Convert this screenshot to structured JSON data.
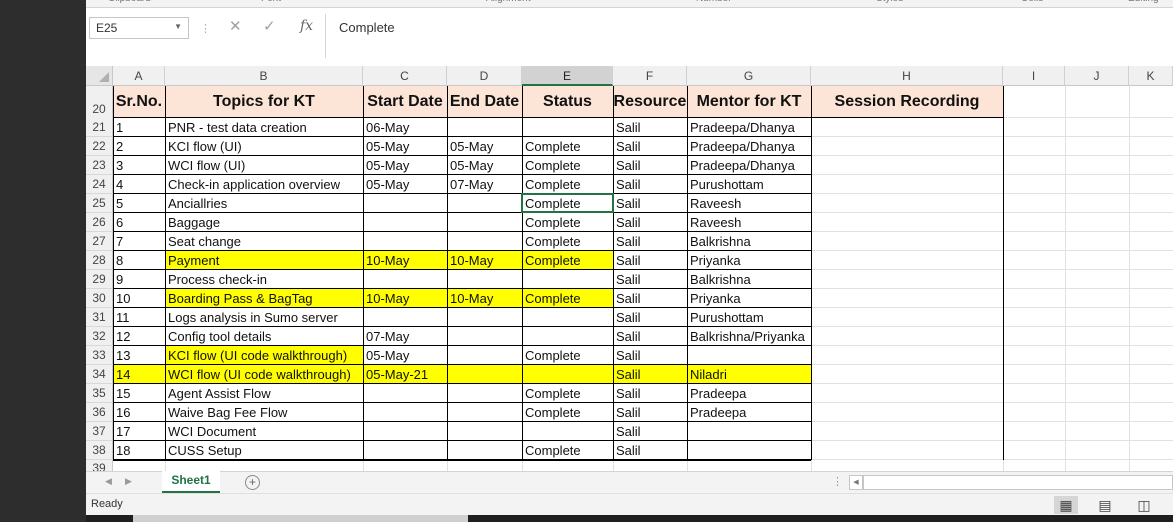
{
  "ribbon": {
    "groups": [
      "Clipboard",
      "Font",
      "Alignment",
      "Number",
      "Styles",
      "Cells",
      "Editing"
    ]
  },
  "formula_bar": {
    "name_box": "E25",
    "content": "Complete"
  },
  "columns": [
    "A",
    "B",
    "C",
    "D",
    "E",
    "F",
    "G",
    "H",
    "I",
    "J",
    "K"
  ],
  "header_row": {
    "row_num": "20",
    "cells": [
      "Sr.No.",
      "Topics for KT",
      "Start Date",
      "End Date",
      "Status",
      "Resource",
      "Mentor for KT",
      "Session Recording"
    ]
  },
  "rows": [
    {
      "row_num": "21",
      "cells": [
        "1",
        "PNR - test data creation",
        "06-May",
        "",
        "",
        "Salil",
        "Pradeepa/Dhanya",
        ""
      ]
    },
    {
      "row_num": "22",
      "cells": [
        "2",
        "KCI flow (UI)",
        "05-May",
        "05-May",
        "Complete",
        "Salil",
        "Pradeepa/Dhanya",
        ""
      ]
    },
    {
      "row_num": "23",
      "cells": [
        "3",
        "WCI flow (UI)",
        "05-May",
        "05-May",
        "Complete",
        "Salil",
        "Pradeepa/Dhanya",
        ""
      ]
    },
    {
      "row_num": "24",
      "cells": [
        "4",
        "Check-in application overview",
        "05-May",
        "07-May",
        "Complete",
        "Salil",
        "Purushottam",
        ""
      ]
    },
    {
      "row_num": "25",
      "cells": [
        "5",
        "Anciallries",
        "",
        "",
        "Complete",
        "Salil",
        "Raveesh",
        ""
      ]
    },
    {
      "row_num": "26",
      "cells": [
        "6",
        "Baggage",
        "",
        "",
        "Complete",
        "Salil",
        "Raveesh",
        ""
      ]
    },
    {
      "row_num": "27",
      "cells": [
        "7",
        "Seat change",
        "",
        "",
        "Complete",
        "Salil",
        "Balkrishna",
        ""
      ]
    },
    {
      "row_num": "28",
      "cells": [
        "8",
        "Payment",
        "10-May",
        "10-May",
        "Complete",
        "Salil",
        "Priyanka",
        ""
      ]
    },
    {
      "row_num": "29",
      "cells": [
        "9",
        "Process check-in",
        "",
        "",
        "",
        "Salil",
        "Balkrishna",
        ""
      ]
    },
    {
      "row_num": "30",
      "cells": [
        "10",
        "Boarding Pass & BagTag",
        "10-May",
        "10-May",
        "Complete",
        "Salil",
        "Priyanka",
        ""
      ]
    },
    {
      "row_num": "31",
      "cells": [
        "11",
        "Logs analysis in Sumo server",
        "",
        "",
        "",
        "Salil",
        "Purushottam",
        ""
      ]
    },
    {
      "row_num": "32",
      "cells": [
        "12",
        "Config tool details",
        "07-May",
        "",
        "",
        "Salil",
        "Balkrishna/Priyanka",
        ""
      ]
    },
    {
      "row_num": "33",
      "cells": [
        "13",
        "KCI flow (UI code walkthrough)",
        "05-May",
        "",
        "Complete",
        "Salil",
        "",
        ""
      ]
    },
    {
      "row_num": "34",
      "cells": [
        "14",
        "WCI flow (UI code walkthrough)",
        "05-May-21",
        "",
        "",
        "Salil",
        "Niladri",
        ""
      ]
    },
    {
      "row_num": "35",
      "cells": [
        "15",
        "Agent Assist Flow",
        "",
        "",
        "Complete",
        "Salil",
        "Pradeepa",
        ""
      ]
    },
    {
      "row_num": "36",
      "cells": [
        "16",
        "Waive Bag Fee Flow",
        "",
        "",
        "Complete",
        "Salil",
        "Pradeepa",
        ""
      ]
    },
    {
      "row_num": "37",
      "cells": [
        "17",
        "WCI Document",
        "",
        "",
        "",
        "Salil",
        "",
        ""
      ]
    },
    {
      "row_num": "38",
      "cells": [
        "18",
        "CUSS Setup",
        "",
        "",
        "Complete",
        "Salil",
        "",
        ""
      ]
    }
  ],
  "partial_row": "39",
  "sheet_tabs": [
    "Sheet1"
  ],
  "status": {
    "text": "Ready"
  },
  "colors": {
    "header_fill": "#fce4d6",
    "highlight": "#ffff00",
    "accent": "#217346"
  }
}
